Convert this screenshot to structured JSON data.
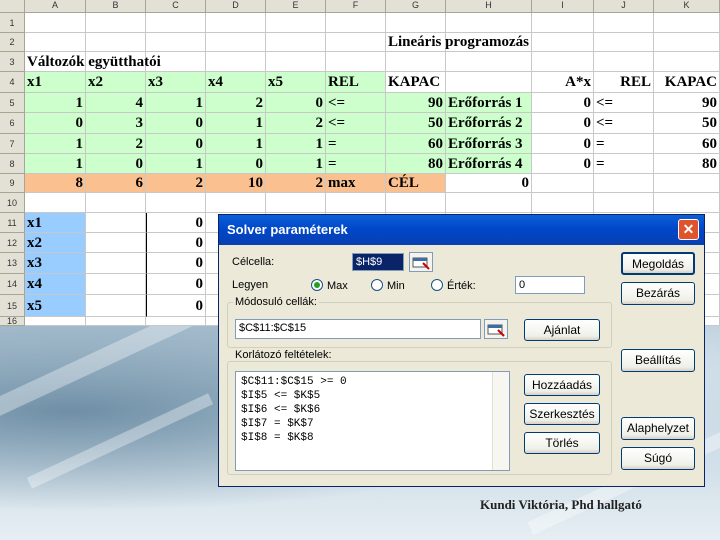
{
  "columns": [
    "A",
    "B",
    "C",
    "D",
    "E",
    "F",
    "G",
    "H",
    "I",
    "J",
    "K"
  ],
  "rows": [
    "1",
    "2",
    "3",
    "4",
    "5",
    "6",
    "7",
    "8",
    "9",
    "10",
    "11",
    "12",
    "13",
    "14",
    "15",
    "16"
  ],
  "sheet": {
    "lp_title": "Lineáris programozás",
    "coef_title": "Változók együtthatói",
    "header": [
      "x1",
      "x2",
      "x3",
      "x4",
      "x5",
      "REL",
      "KAPAC"
    ],
    "rhs_header": [
      "A*x",
      "REL",
      "KAPAC"
    ],
    "data_rows": [
      {
        "v": [
          "1",
          "4",
          "1",
          "2",
          "0"
        ],
        "rel": "<=",
        "kap": "90",
        "res": "Erőforrás 1",
        "ax": "0",
        "rrel": "<=",
        "rkap": "90"
      },
      {
        "v": [
          "0",
          "3",
          "0",
          "1",
          "2"
        ],
        "rel": "<=",
        "kap": "50",
        "res": "Erőforrás 2",
        "ax": "0",
        "rrel": "<=",
        "rkap": "50"
      },
      {
        "v": [
          "1",
          "2",
          "0",
          "1",
          "1"
        ],
        "rel": "=",
        "kap": "60",
        "res": "Erőforrás 3",
        "ax": "0",
        "rrel": "=",
        "rkap": "60"
      },
      {
        "v": [
          "1",
          "0",
          "1",
          "0",
          "1"
        ],
        "rel": "=",
        "kap": "80",
        "res": "Erőforrás 4",
        "ax": "0",
        "rrel": "=",
        "rkap": "80"
      }
    ],
    "objective": {
      "v": [
        "8",
        "6",
        "2",
        "10",
        "2"
      ],
      "rel": "max",
      "label": "CÉL",
      "value": "0"
    },
    "var_names": [
      "x1",
      "x2",
      "x3",
      "x4",
      "x5"
    ],
    "var_values": [
      "0",
      "0",
      "0",
      "0",
      "0"
    ]
  },
  "solver": {
    "title": "Solver paraméterek",
    "close": "✕",
    "target_label": "Célcella:",
    "target_value": "$H$9",
    "equal_label": "Legyen",
    "opt_max": "Max",
    "opt_min": "Min",
    "opt_value": "Érték:",
    "value_field": "0",
    "changing_label": "Módosuló cellák:",
    "changing_value": "$C$11:$C$15",
    "guess_button": "Ajánlat",
    "constraints_label": "Korlátozó feltételek:",
    "constraints": [
      "$C$11:$C$15 >= 0",
      "$I$5 <= $K$5",
      "$I$6 <= $K$6",
      "$I$7 = $K$7",
      "$I$8 = $K$8"
    ],
    "buttons": {
      "solve": "Megoldás",
      "close": "Bezárás",
      "options": "Beállítás",
      "add": "Hozzáadás",
      "change": "Szerkesztés",
      "delete": "Törlés",
      "reset": "Alaphelyzet",
      "help": "Súgó"
    }
  },
  "caption": "Kundi Viktória, Phd hallgató",
  "colors": {
    "green": "#ccffcc",
    "orange": "#fac090",
    "blue": "#99ccff",
    "titlebar": "#0046c8"
  }
}
